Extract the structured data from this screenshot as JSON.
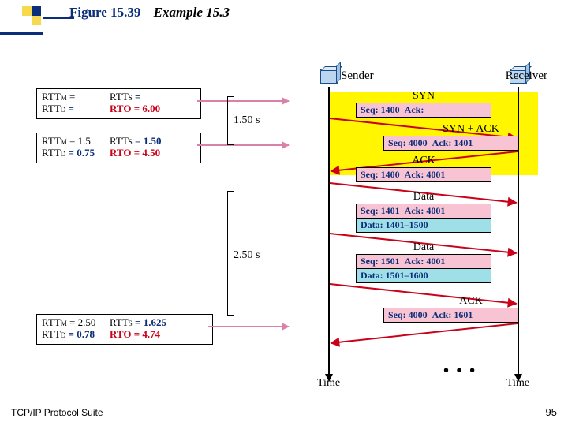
{
  "title": {
    "figure": "Figure 15.39",
    "example": "Example 15.3"
  },
  "footer": {
    "left": "TCP/IP Protocol Suite",
    "page": "95"
  },
  "mboxes": [
    {
      "rttM_label": "RTT",
      "rttM_sub": "M",
      "rttM_val": "=",
      "rttD_label": "RTT",
      "rttD_sub": "D",
      "rttD_val": "=",
      "rttS_label": "RTT",
      "rttS_sub": "S",
      "rttS_val": "=",
      "rto_label": "RTO = 6.00"
    },
    {
      "rttM_label": "RTT",
      "rttM_sub": "M",
      "rttM_val": "= 1.5",
      "rttD_label": "RTT",
      "rttD_sub": "D",
      "rttD_val": "= 0.75",
      "rttS_label": "RTT",
      "rttS_sub": "S",
      "rttS_val": "= 1.50",
      "rto_label": "RTO = 4.50"
    },
    {
      "rttM_label": "RTT",
      "rttM_sub": "M",
      "rttM_val": "= 2.50",
      "rttD_label": "RTT",
      "rttD_sub": "D",
      "rttD_val": "= 0.78",
      "rttS_label": "RTT",
      "rttS_sub": "S",
      "rttS_val": "= 1.625",
      "rto_label": "RTO = 4.74"
    }
  ],
  "intervals": [
    {
      "label": "1.50 s"
    },
    {
      "label": "2.50 s"
    }
  ],
  "hosts": {
    "sender": "Sender",
    "receiver": "Receiver",
    "time": "Time"
  },
  "messages": [
    {
      "dir": "fwd",
      "label": "SYN",
      "seq": "Seq: 1400",
      "ack": "Ack:"
    },
    {
      "dir": "back",
      "label": "SYN + ACK",
      "seq": "Seq: 4000",
      "ack": "Ack: 1401"
    },
    {
      "dir": "fwd",
      "label": "ACK",
      "seq": "Seq: 1400",
      "ack": "Ack: 4001"
    },
    {
      "dir": "fwd",
      "label": "Data",
      "seq": "Seq: 1401",
      "ack": "Ack: 4001",
      "data": "Data: 1401–1500"
    },
    {
      "dir": "fwd",
      "label": "Data",
      "seq": "Seq: 1501",
      "ack": "Ack: 4001",
      "data": "Data: 1501–1600"
    },
    {
      "dir": "back",
      "label": "ACK",
      "seq": "Seq: 4000",
      "ack": "Ack: 1601"
    }
  ]
}
